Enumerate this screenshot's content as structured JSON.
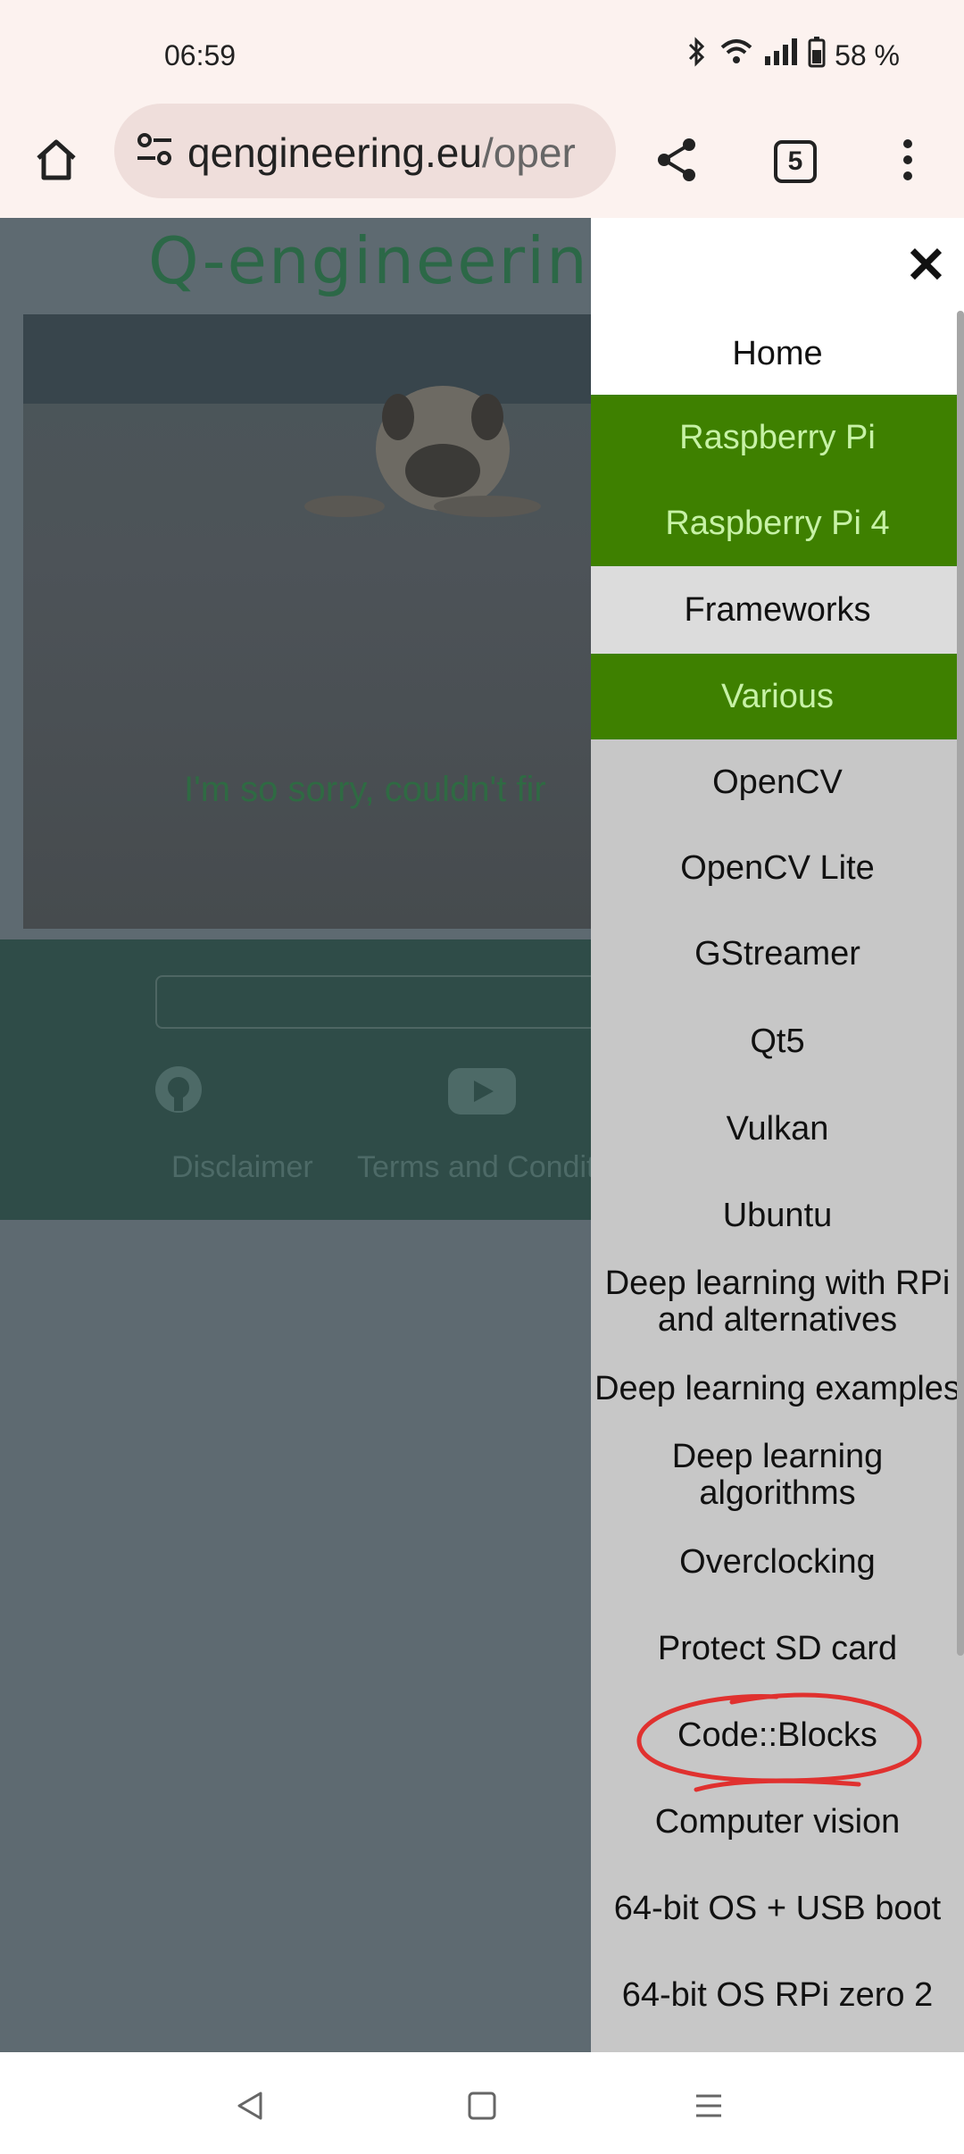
{
  "status": {
    "time": "06:59",
    "battery": "58 %"
  },
  "browser": {
    "url_domain": "qengineering.eu",
    "url_path": "/oper",
    "tab_count": "5"
  },
  "page": {
    "brand": "Q-engineering",
    "message": "I'm so sorry, couldn't fir",
    "footer_links": [
      "Disclaimer",
      "Terms and Condit"
    ]
  },
  "menu": {
    "close_label": "✕",
    "items": [
      "Home",
      "Raspberry Pi",
      "Raspberry Pi 4",
      "Frameworks",
      "Various",
      "OpenCV",
      "OpenCV Lite",
      "GStreamer",
      "Qt5",
      "Vulkan",
      "Ubuntu",
      "Deep learning with RPi and alternatives",
      "Deep learning examples",
      "Deep learning algorithms",
      "Overclocking",
      "Protect SD card",
      "Code::Blocks",
      "Computer vision",
      "64-bit OS + USB boot",
      "64-bit OS RPi zero 2"
    ]
  },
  "colors": {
    "accent_green": "#3e8000",
    "highlight_red": "#e0312f",
    "menu_bg": "#c7c7c7"
  }
}
